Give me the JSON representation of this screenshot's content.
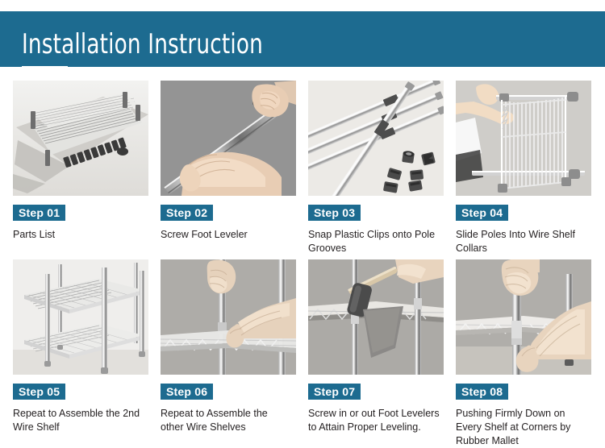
{
  "header": {
    "title": "Installation Instruction",
    "background_color": "#1d6b90",
    "text_color": "#ffffff"
  },
  "theme": {
    "accent_color": "#1d6b90",
    "badge_text_color": "#ffffff",
    "caption_color": "#231f20",
    "page_background": "#ffffff"
  },
  "steps": [
    {
      "badge": "Step 01",
      "caption": "Parts List",
      "image_name": "parts-list-photo",
      "image_alt": "Stacked chrome wire shelves lying flat on cardboard with a row of black plastic clips beside them"
    },
    {
      "badge": "Step 02",
      "caption": "Screw Foot Leveler",
      "image_name": "screw-foot-leveler-photo",
      "image_alt": "Two hands screwing a foot leveler onto the end of a chrome pole"
    },
    {
      "badge": "Step 03",
      "caption": "Snap Plastic Clips onto Pole Grooves",
      "image_name": "snap-plastic-clips-photo",
      "image_alt": "Four chrome poles with dark plastic clips attached and loose clips nearby"
    },
    {
      "badge": "Step 04",
      "caption": " Slide Poles Into Wire Shelf Collars",
      "image_name": "slide-poles-photo",
      "image_alt": "A person sliding poles into the corner collars of an upright wire shelf"
    },
    {
      "badge": "Step 05",
      "caption": "Repeat to Assemble the 2nd Wire Shelf",
      "image_name": "second-wire-shelf-photo",
      "image_alt": "Assembled two tier chrome wire shelving unit"
    },
    {
      "badge": "Step 06",
      "caption": "Repeat to Assemble the other Wire Shelves",
      "image_name": "other-wire-shelves-photo",
      "image_alt": "Two hands guiding a wire shelf down over the vertical poles"
    },
    {
      "badge": "Step 07",
      "caption": "Screw in or out Foot Levelers to Attain Proper Leveling.",
      "image_name": "foot-leveler-adjust-photo",
      "image_alt": "A rubber mallet tapping a shelf collar on a chrome pole"
    },
    {
      "badge": "Step 08",
      "caption": "Pushing Firmly Down on Every Shelf at Corners by Rubber Mallet",
      "image_name": "push-down-shelf-photo",
      "image_alt": "Hands pushing firmly down on the corner of a wire shelf"
    }
  ]
}
